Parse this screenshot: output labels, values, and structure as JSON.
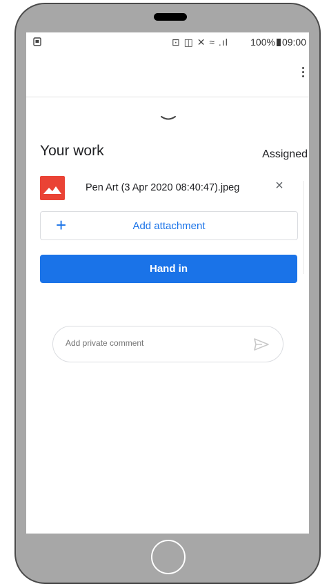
{
  "status_bar": {
    "left_icon": "screenshot-icon",
    "icons": "⊡ ◫ ✕ ≈ .ıl",
    "battery": "100%",
    "time": "09:00"
  },
  "header": {
    "menu_icon": "more-vert-icon"
  },
  "work": {
    "title": "Your work",
    "status": "Assigned",
    "attachment": {
      "file_name": "Pen Art (3 Apr 2020 08:40:47).jpeg",
      "icon": "image-icon",
      "remove_symbol": "×"
    },
    "add_attachment": {
      "plus": "+",
      "label": "Add attachment"
    },
    "hand_in_label": "Hand in"
  },
  "comment": {
    "placeholder": "Add private comment",
    "send_icon": "send-icon"
  },
  "colors": {
    "accent": "#1a73e8",
    "file_icon": "#ea4335",
    "phone_frame": "#a7a7a7"
  }
}
